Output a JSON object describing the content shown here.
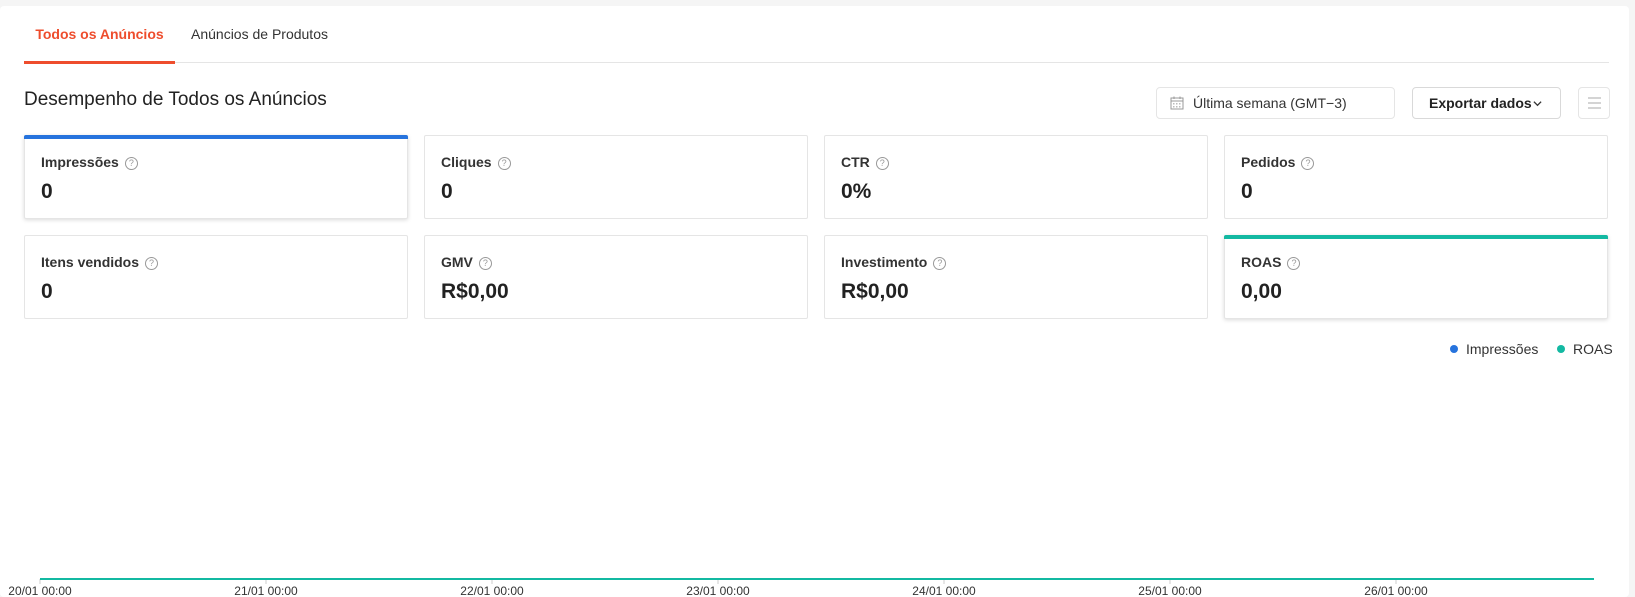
{
  "tabs": [
    {
      "label": "Todos os Anúncios",
      "active": true
    },
    {
      "label": "Anúncios de Produtos",
      "active": false
    }
  ],
  "page_title": "Desempenho de Todos os Anúncios",
  "date_picker": {
    "value": "Última semana (GMT−3)",
    "icon": "calendar-icon"
  },
  "export_button": {
    "label": "Exportar dados",
    "icon": "chevron-down-icon"
  },
  "menu_button": {
    "icon": "list-menu-icon"
  },
  "colors": {
    "accent": "#ee4d2d",
    "impressions": "#2673dd",
    "roas": "#13b9a2"
  },
  "metrics": [
    {
      "label": "Impressões",
      "value": "0",
      "selected": true,
      "color": "#2673dd"
    },
    {
      "label": "Cliques",
      "value": "0",
      "selected": false
    },
    {
      "label": "CTR",
      "value": "0%",
      "selected": false
    },
    {
      "label": "Pedidos",
      "value": "0",
      "selected": false
    },
    {
      "label": "Itens vendidos",
      "value": "0",
      "selected": false
    },
    {
      "label": "GMV",
      "value": "R$0,00",
      "selected": false
    },
    {
      "label": "Investimento",
      "value": "R$0,00",
      "selected": false
    },
    {
      "label": "ROAS",
      "value": "0,00",
      "selected": true,
      "color": "#13b9a2"
    }
  ],
  "legend": [
    "Impressões",
    "ROAS"
  ],
  "chart_data": {
    "type": "line",
    "x": [
      "20/01 00:00",
      "21/01 00:00",
      "22/01 00:00",
      "23/01 00:00",
      "24/01 00:00",
      "25/01 00:00",
      "26/01 00:00"
    ],
    "series": [
      {
        "name": "Impressões",
        "values": [
          0,
          0,
          0,
          0,
          0,
          0,
          0
        ],
        "color": "#2673dd"
      },
      {
        "name": "ROAS",
        "values": [
          0,
          0,
          0,
          0,
          0,
          0,
          0
        ],
        "color": "#13b9a2"
      }
    ],
    "grid": false,
    "legend_position": "top-right"
  }
}
